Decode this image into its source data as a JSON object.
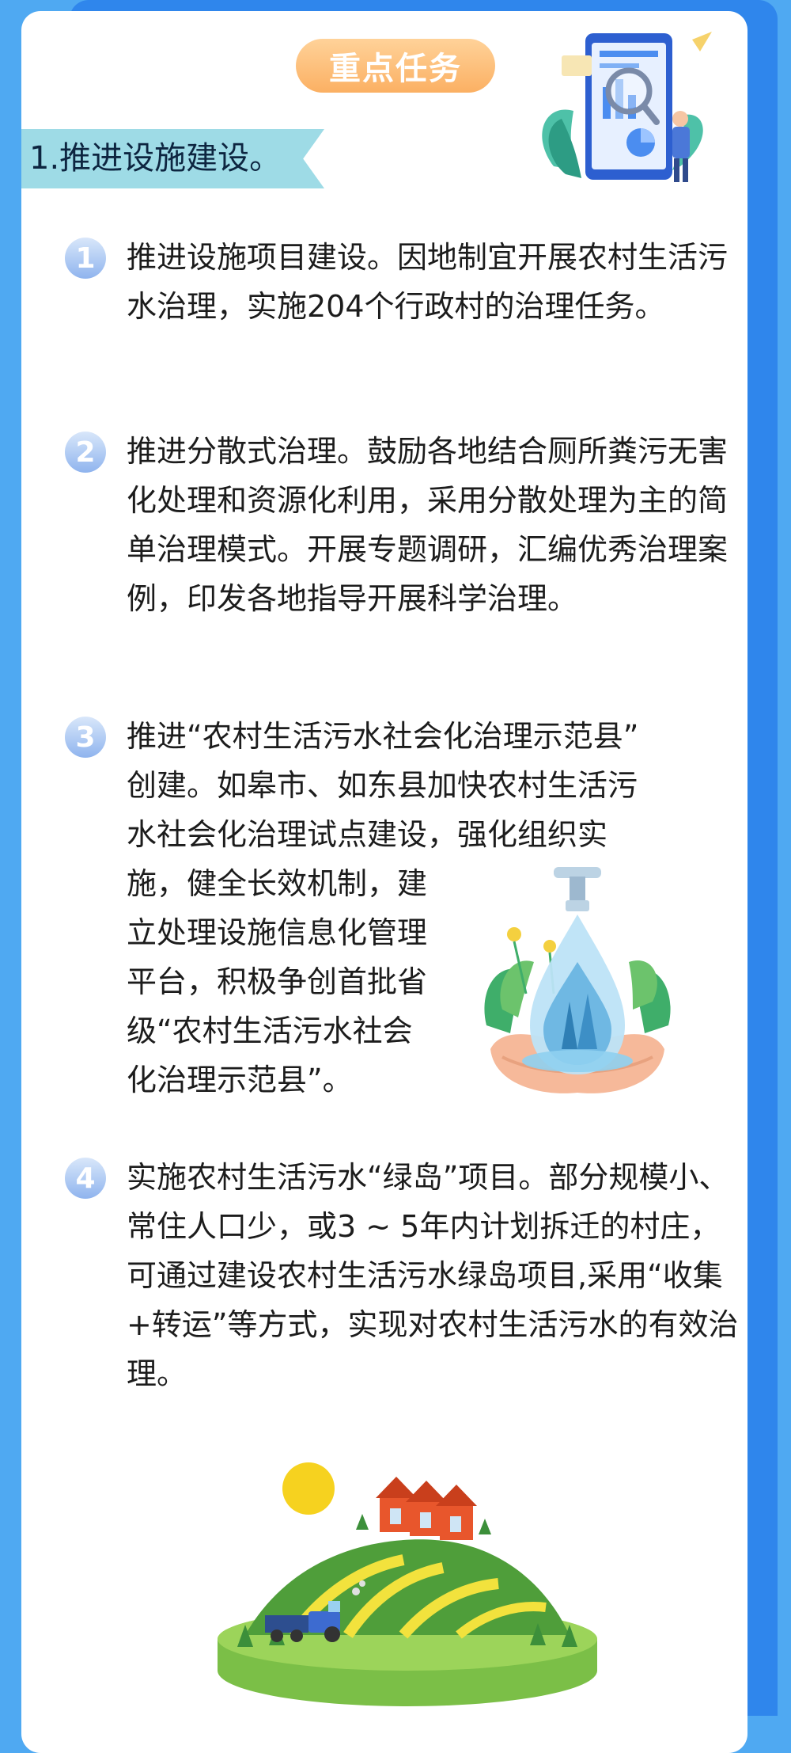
{
  "header": {
    "pill_label": "重点任务"
  },
  "section": {
    "title": "1.推进设施建设。"
  },
  "tasks": [
    {
      "number": "1",
      "text": "推进设施项目建设。因地制宜开展农村生活污水治理，实施204个行政村的治理任务。"
    },
    {
      "number": "2",
      "text": "推进分散式治理。鼓励各地结合厕所粪污无害化处理和资源化利用，采用分散处理为主的简单治理模式。开展专题调研，汇编优秀治理案例，印发各地指导开展科学治理。"
    },
    {
      "number": "3",
      "lines": [
        "推进“农村生活污水社会化治理示范县”",
        "创建。如皋市、如东县加快农村生活污",
        "水社会化治理试点建设，强化组织实",
        "施，健全长效机制，建",
        "立处理设施信息化管理",
        "平台，积极争创首批省",
        "级“农村生活污水社会",
        "化治理示范县”。"
      ]
    },
    {
      "number": "4",
      "text": "实施农村生活污水“绿岛”项目。部分规模小、常住人口少，或3 ~ 5年内计划拆迁的村庄，可通过建设农村生活污水绿岛项目,采用“收集+转运”等方式，实现对农村生活污水的有效治理。"
    }
  ],
  "colors": {
    "page_background": "#4fa9f2",
    "accent_blue": "#2f86ec",
    "pill_orange": "#fbb063",
    "ribbon_teal": "#9edbe6",
    "body_text": "#1c1c1c"
  },
  "illustrations": {
    "top_right": "phone-analytics-illustration",
    "water_drop": "water-drop-hands-illustration",
    "farm": "farm-hill-illustration"
  }
}
